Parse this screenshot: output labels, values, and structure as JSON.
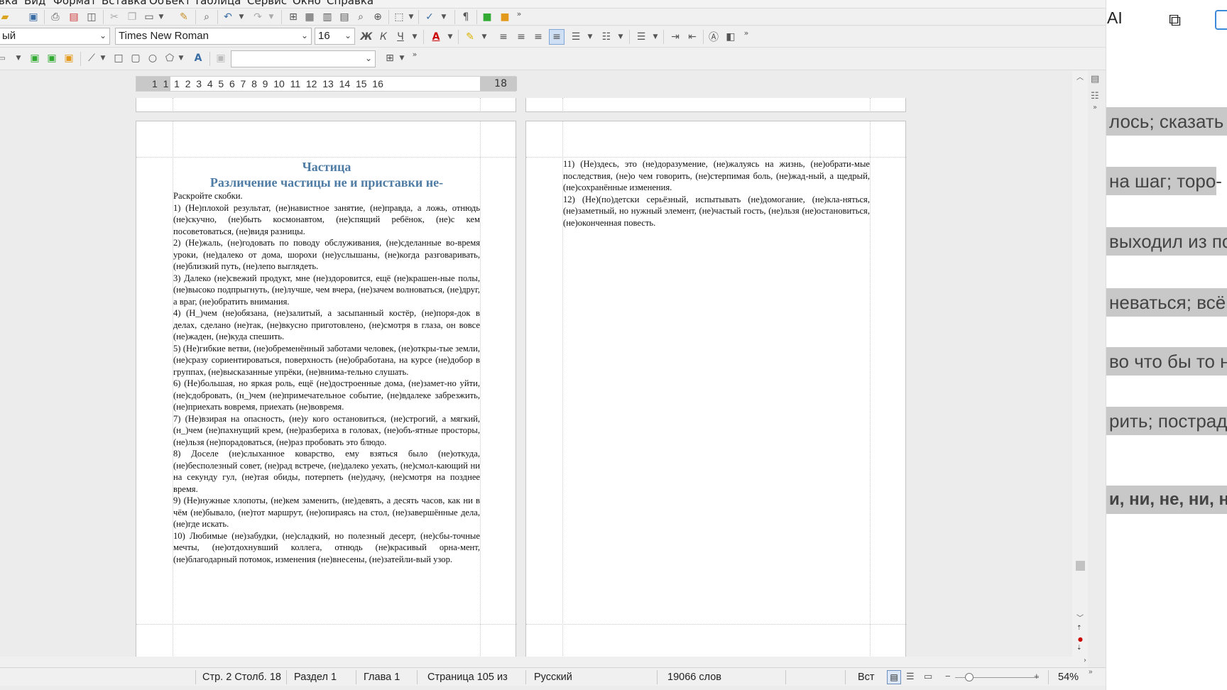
{
  "menubar": {
    "items": [
      "вка",
      "Вид",
      "Формат",
      "Вставка",
      "Объект",
      "Таблица",
      "Сервис",
      "Окно",
      "Справка"
    ]
  },
  "toolbar2": {
    "style_value": "ый",
    "font_name": "Times New Roman",
    "font_size": "16",
    "bold": "Ж",
    "italic": "К",
    "underline": "Ч"
  },
  "ruler": {
    "numbers": "1  1  1  2  3  4  5  6  7  8  9  10  11  12  13  14  15  16",
    "last": "18"
  },
  "page1": {
    "title1": "Частица",
    "title2": "Различение частицы не и приставки не-",
    "intro": "Раскройте скобки.",
    "lines": [
      "1) (Не)плохой результат, (не)навистное занятие, (не)правда, а ложь, отнюдь (не)скучно, (не)быть космонавтом, (не)спящий ребёнок, (не)с кем посоветоваться, (не)видя разницы.",
      "2) (Не)жаль, (не)годовать по поводу обслуживания, (не)сделанные во-время уроки, (не)далеко от дома, шорохи (не)услышаны, (не)когда разговаривать, (не)близкий путь, (не)лепо выглядеть.",
      "3) Далеко (не)свежий продукт, мне (не)здоровится, ещё (не)крашен-ные полы, (не)высоко подпрыгнуть, (не)лучше, чем вчера, (не)зачем волноваться, (не)друг, а враг, (не)обратить внимания.",
      "4) (Н_)чем (не)обязана, (не)залитый, а засыпанный костёр, (не)поря-док в делах, сделано (не)так, (не)вкусно приготовлено, (не)смотря в глаза, он вовсе (не)жаден, (не)куда спешить.",
      "5) (Не)гибкие ветви, (не)обременённый заботами человек, (не)откры-тые земли, (не)сразу сориентироваться, поверхность (не)обработана, на курсе (не)добор в группах, (не)высказанные упрёки, (не)внима-тельно слушать.",
      "6) (Не)большая, но яркая роль, ещё (не)достроенные дома, (не)замет-но уйти, (не)сдобровать, (н_)чем (не)примечательное событие, (не)вдалеке забрезжить, (не)приехать вовремя, приехать (не)вовремя.",
      "7) (Не)взирая на опасность, (не)у кого остановиться, (не)строгий, а мягкий, (н_)чем (не)пахнущий крем, (не)разбериха в головах, (не)объ-ятные просторы, (не)льзя (не)порадоваться, (не)раз пробовать это блюдо.",
      "8) Доселе (не)слыханное коварство, ему взяться было (не)откуда, (не)бесполезный совет, (не)рад встрече, (не)далеко уехать, (не)смол-кающий ни на секунду гул, (не)тая обиды, потерпеть (не)удачу, (не)смотря на позднее время.",
      "9) (Не)нужные хлопоты, (не)кем заменить, (не)девять, а десять часов, как ни в чём (не)бывало, (не)тот маршрут, (не)опираясь на стол, (не)завершённые дела, (не)где искать.",
      "10) Любимые (не)забудки, (не)сладкий, но полезный десерт, (не)сбы-точные мечты, (не)отдохнувший коллега, отнюдь (не)красивый орна-мент, (не)благодарный потомок, изменения (не)внесены, (не)затейли-вый узор."
    ]
  },
  "page2": {
    "lines": [
      "11) (Не)здесь, это (не)доразумение, (не)жалуясь на жизнь, (не)обрати-мые последствия, (не)о чем говорить, (не)стерпимая боль, (не)жад-ный, а щедрый, (не)сохранённые изменения.",
      "12) (Не)(по)детски серьёзный, испытывать (не)домогание, (не)кла-няться, (не)заметный, но нужный элемент, (не)частый гость, (не)льзя (не)остановиться, (не)оконченная повесть."
    ]
  },
  "status": {
    "page_col": "Стр. 2 Столб. 18",
    "section": "Раздел 1",
    "chapter": "Глава 1",
    "page_count": "Страница 105 из",
    "language": "Русский",
    "words": "19066 слов",
    "mode": "Вст",
    "zoom": "54%"
  },
  "right_panel": {
    "ai": "AI",
    "bands": [
      "лось; сказать",
      "на шаг; торо-",
      "выходил из по",
      "неваться; всё",
      "во что бы то н",
      "рить; пострад",
      "и, ни, не, ни, н"
    ]
  }
}
